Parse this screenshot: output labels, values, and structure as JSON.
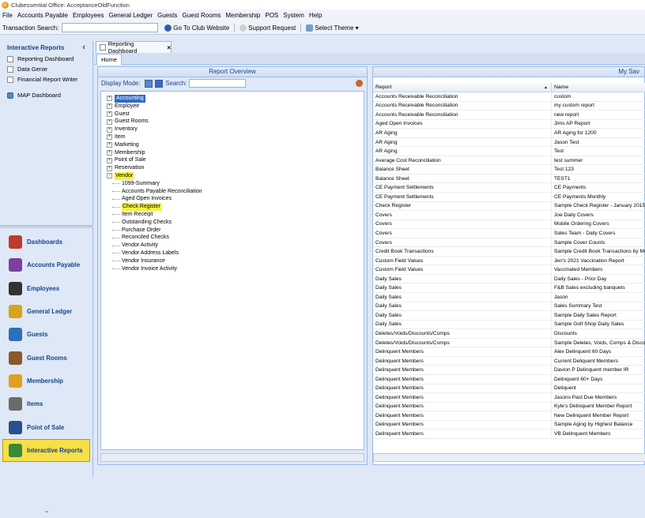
{
  "window": {
    "title": "Clubessential Office: AcceptanceOldFunction"
  },
  "menu": [
    "File",
    "Accounts Payable",
    "Employees",
    "General Ledger",
    "Guests",
    "Guest Rooms",
    "Membership",
    "POS",
    "System",
    "Help"
  ],
  "toolbar": {
    "search_label": "Transaction Search:",
    "search_value": "",
    "club_website": "Go To Club Website",
    "support": "Support Request",
    "theme": "Select Theme ▾"
  },
  "sidebar": {
    "title": "Interactive Reports",
    "collapse_glyph": "‹",
    "links": [
      {
        "label": "Reporting Dashboard",
        "icon": "document-icon"
      },
      {
        "label": "Data Genie",
        "icon": "document-icon"
      },
      {
        "label": "Financial Report Writer",
        "icon": "document-icon"
      },
      {
        "label": "MAP Dashboard",
        "icon": "map-icon"
      }
    ],
    "nav": [
      {
        "label": "Dashboards",
        "icon": "dashboards-icon",
        "color": "#c0392b"
      },
      {
        "label": "Accounts Payable",
        "icon": "accounts-payable-icon",
        "color": "#7b3fa0"
      },
      {
        "label": "Employees",
        "icon": "employees-icon",
        "color": "#333333"
      },
      {
        "label": "General Ledger",
        "icon": "general-ledger-icon",
        "color": "#d9a31e"
      },
      {
        "label": "Guests",
        "icon": "guests-icon",
        "color": "#2c6fbb"
      },
      {
        "label": "Guest Rooms",
        "icon": "guest-rooms-icon",
        "color": "#8b5a2b"
      },
      {
        "label": "Membership",
        "icon": "membership-icon",
        "color": "#e0a020"
      },
      {
        "label": "Items",
        "icon": "items-icon",
        "color": "#6a6a6a"
      },
      {
        "label": "Point of Sale",
        "icon": "point-of-sale-icon",
        "color": "#2a4f8f"
      },
      {
        "label": "Interactive Reports",
        "icon": "interactive-reports-icon",
        "color": "#3a8a3a",
        "active": true
      }
    ],
    "more_glyph": "⌄"
  },
  "doc_tab": {
    "label": "Reporting Dashboard",
    "close": "×"
  },
  "home_tab": "Home",
  "report_overview": {
    "title": "Report Overview",
    "display_mode_label": "Display Mode:",
    "search_label": "Search:",
    "search_value": "",
    "tree": [
      {
        "label": "Accounting",
        "level": 0,
        "toggle": "+",
        "selected": true
      },
      {
        "label": "Employee",
        "level": 0,
        "toggle": "+"
      },
      {
        "label": "Guest",
        "level": 0,
        "toggle": "+"
      },
      {
        "label": "Guest Rooms",
        "level": 0,
        "toggle": "+"
      },
      {
        "label": "Inventory",
        "level": 0,
        "toggle": "+"
      },
      {
        "label": "Item",
        "level": 0,
        "toggle": "+"
      },
      {
        "label": "Marketing",
        "level": 0,
        "toggle": "+"
      },
      {
        "label": "Membership",
        "level": 0,
        "toggle": "+"
      },
      {
        "label": "Point of Sale",
        "level": 0,
        "toggle": "+"
      },
      {
        "label": "Reservation",
        "level": 0,
        "toggle": "+"
      },
      {
        "label": "Vendor",
        "level": 0,
        "toggle": "−",
        "highlight": true
      },
      {
        "label": "1099-Summary",
        "level": 1
      },
      {
        "label": "Accounts Payable Reconciliation",
        "level": 1
      },
      {
        "label": "Aged Open Invoices",
        "level": 1
      },
      {
        "label": "Check Register",
        "level": 1,
        "highlight": true
      },
      {
        "label": "Item Receipt",
        "level": 1
      },
      {
        "label": "Outstanding Checks",
        "level": 1
      },
      {
        "label": "Purchase Order",
        "level": 1
      },
      {
        "label": "Reconciled Checks",
        "level": 1
      },
      {
        "label": "Vendor Activity",
        "level": 1
      },
      {
        "label": "Vendor Address Labels",
        "level": 1
      },
      {
        "label": "Vendor Insurance",
        "level": 1
      },
      {
        "label": "Vendor Invoice Activity",
        "level": 1
      }
    ]
  },
  "saved": {
    "title": "My Sav",
    "columns": [
      "Report",
      "Name"
    ],
    "sort_glyph": "▲",
    "rows": [
      [
        "Accounts Receivable Reconciliation",
        "custom"
      ],
      [
        "Accounts Receivable Reconciliation",
        "my custom report"
      ],
      [
        "Accounts Receivable Reconciliation",
        "new report"
      ],
      [
        "Aged Open Invoices",
        "Jims AP Report"
      ],
      [
        "AR Aging",
        "AR Aging for 1200"
      ],
      [
        "AR Aging",
        "Jason Test"
      ],
      [
        "AR Aging",
        "Test"
      ],
      [
        "Average Cost Reconciliation",
        "test summer"
      ],
      [
        "Balance Sheet",
        "Test 123"
      ],
      [
        "Balance Sheet",
        "TEST1"
      ],
      [
        "CE Payment Settlements",
        "CE Payments"
      ],
      [
        "CE Payment Settlements",
        "CE Payments Monthly"
      ],
      [
        "Check Register",
        "Sample Check Register - January 2015"
      ],
      [
        "Covers",
        "Joe Daily Covers"
      ],
      [
        "Covers",
        "Mobile Ordering Covers"
      ],
      [
        "Covers",
        "Sales Team - Daily Covers"
      ],
      [
        "Covers",
        "Sample Cover Counts"
      ],
      [
        "Credit Book Transactions",
        "Sample Credit Book Transactions by Me"
      ],
      [
        "Custom Field Values",
        "Jen's 2021 Vaccination Report"
      ],
      [
        "Custom Field Values",
        "Vaccinated Members"
      ],
      [
        "Daily Sales",
        "Daily Sales - Prior Day"
      ],
      [
        "Daily Sales",
        "F&B Sales excluding banquets"
      ],
      [
        "Daily Sales",
        "Jason"
      ],
      [
        "Daily Sales",
        "Sales Summary Test"
      ],
      [
        "Daily Sales",
        "Sample Daily Sales Report"
      ],
      [
        "Daily Sales",
        "Sample Golf Shop Daily Sales"
      ],
      [
        "Deletes/Voids/Discounts/Comps",
        "Discounts"
      ],
      [
        "Deletes/Voids/Discounts/Comps",
        "Sample Deletes, Voids, Comps & Discou"
      ],
      [
        "Delinquent Members",
        "Alex Delinquent 60 Days"
      ],
      [
        "Delinquent Members",
        "Current Deliquent Members"
      ],
      [
        "Delinquent Members",
        "Davion P  Delinquent member IR"
      ],
      [
        "Delinquent Members",
        "Delinquent 60+ Days"
      ],
      [
        "Delinquent Members",
        "Deliquent"
      ],
      [
        "Delinquent Members",
        "Jasons Past Due Members"
      ],
      [
        "Delinquent Members",
        "Kyle's Delinquent Member Report"
      ],
      [
        "Delinquent Members",
        "New Delinquent Member Report"
      ],
      [
        "Delinquent Members",
        "Sample Aging by Highest Balance"
      ],
      [
        "Delinquent Members",
        "VB Delinquent Members"
      ]
    ]
  }
}
